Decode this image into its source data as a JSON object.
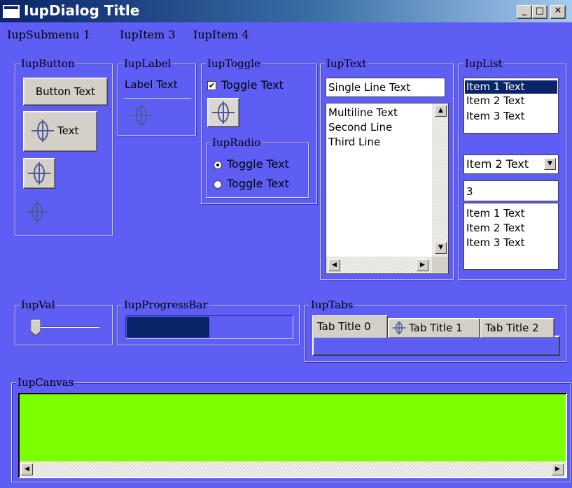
{
  "window": {
    "title": "IupDialog Title"
  },
  "menu": {
    "items": [
      "IupSubmenu 1",
      "IupItem 3",
      "IupItem 4"
    ]
  },
  "frames": {
    "button": "IupButton",
    "label": "IupLabel",
    "toggle": "IupToggle",
    "radio": "IupRadio",
    "text": "IupText",
    "list": "IupList",
    "val": "IupVal",
    "progress": "IupProgressBar",
    "tabs": "IupTabs",
    "canvas": "IupCanvas"
  },
  "button": {
    "text_button": "Button Text",
    "image_text_button": "Text"
  },
  "label": {
    "text": "Label Text"
  },
  "toggle": {
    "text": "Toggle Text",
    "checked": true
  },
  "radio": {
    "options": [
      "Toggle Text",
      "Toggle Text"
    ],
    "selected_index": 0
  },
  "text": {
    "single_line": "Single Line Text",
    "multiline": [
      "Multiline Text",
      "Second Line",
      "Third Line"
    ]
  },
  "list": {
    "items": [
      "Item 1 Text",
      "Item 2 Text",
      "Item 3 Text"
    ],
    "selected_index": 0,
    "dropdown_value": "Item 2 Text",
    "edit_value": "3",
    "edit_items": [
      "Item 1 Text",
      "Item 2 Text",
      "Item 3 Text"
    ]
  },
  "val": {
    "value": 0.0
  },
  "progress": {
    "fraction": 0.5
  },
  "tabs": {
    "titles": [
      "Tab Title 0",
      "Tab Title 1",
      "Tab Title 2"
    ],
    "active_index": 0
  },
  "canvas": {
    "background": "#7dff00"
  },
  "colors": {
    "dialog_bg": "#5e5ef5",
    "selection": "#0a246a",
    "progress_fill": "#0a246a"
  }
}
